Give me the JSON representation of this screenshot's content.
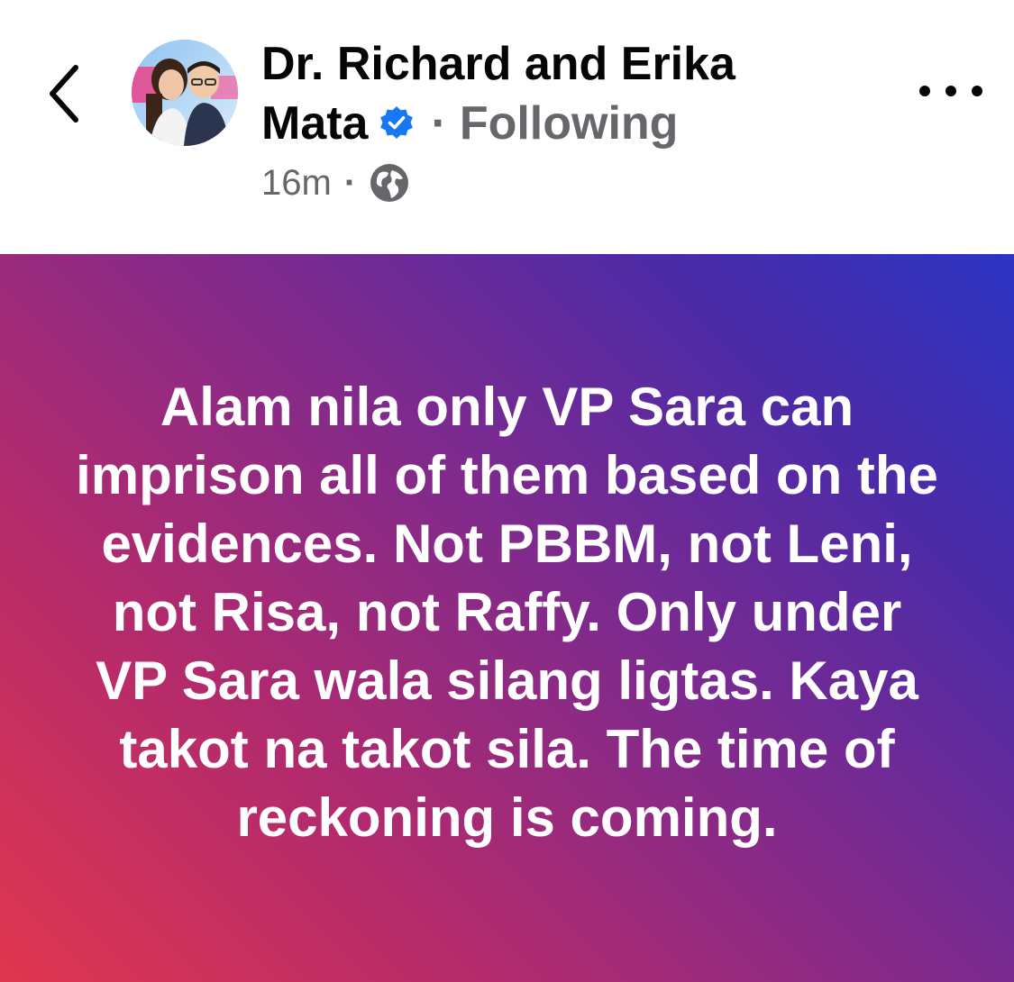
{
  "post": {
    "author_name_line1": "Dr. Richard and Erika",
    "author_name_line2": "Mata",
    "follow_status": "Following",
    "dot": "·",
    "timestamp": "16m",
    "audience_icon": "globe-icon",
    "verified_icon": "verified-badge-icon",
    "body_text": "Alam nila only VP Sara can imprison all of them based on the evidences. Not PBBM, not Leni, not Risa, not Raffy. Only under VP Sara wala silang ligtas. Kaya takot na takot sila. The time of reckoning is coming.",
    "colors": {
      "gradient_start": "#e0364e",
      "gradient_mid": "#7a2a90",
      "gradient_end": "#2d35c4",
      "verified": "#1877f2",
      "secondary_text": "#65676b"
    }
  },
  "nav": {
    "back_icon": "chevron-left-icon",
    "more_icon": "more-horizontal-icon"
  }
}
